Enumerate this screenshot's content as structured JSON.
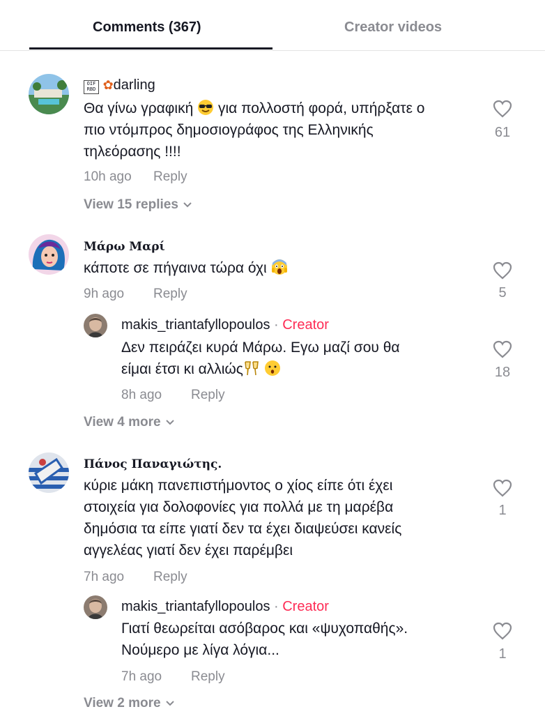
{
  "tabs": {
    "comments": "Comments (367)",
    "creator_videos": "Creator videos"
  },
  "comments": [
    {
      "username": "darling",
      "text_line1a": "Θα γίνω γραφική ",
      "text_line1b": "για πολλοστή φορά, υπήρξατε ο",
      "text_line2": "πιο ντόμπρος δημοσιογράφος της Ελληνικής",
      "text_line3": "τηλεόρασης !!!!",
      "time": "10h ago",
      "reply": "Reply",
      "likes": "61",
      "view_more": "View 15 replies"
    },
    {
      "username": "Μάρω Μαρί",
      "text": "κάποτε σε πήγαινα τώρα όχι ",
      "time": "9h ago",
      "reply": "Reply",
      "likes": "5",
      "reply_item": {
        "username": "makis_triantafyllopoulos",
        "sep": " · ",
        "badge": "Creator",
        "text_line1": "Δεν πειράζει κυρά Μάρω. Εγω μαζί σου θα",
        "text_line2": "είμαι έτσι κι αλλιώς",
        "time": "8h ago",
        "reply": "Reply",
        "likes": "18"
      },
      "view_more": "View 4 more"
    },
    {
      "username": "Πάνος Παναγιώτης.",
      "text_line1": "κύριε μάκη πανεπιστήμοντος ο χίος είπε ότι έχει",
      "text_line2": "στοιχεία για δολοφονίες για πολλά με τη μαρέβα",
      "text_line3": "δημόσια τα είπε γιατί δεν τα έχει διαψεύσει κανείς",
      "text_line4": "αγγελέας γιατί δεν έχει παρέμβει",
      "time": "7h ago",
      "reply": "Reply",
      "likes": "1",
      "reply_item": {
        "username": "makis_triantafyllopoulos",
        "sep": " · ",
        "badge": "Creator",
        "text_line1": "Γιατί θεωρείται ασόβαρος και «ψυχοπαθής».",
        "text_line2": "Νούμερο με λίγα λόγια...",
        "time": "7h ago",
        "reply": "Reply",
        "likes": "1"
      },
      "view_more": "View 2 more"
    }
  ],
  "colors": {
    "accent": "#fe2c55",
    "text": "#161823",
    "muted": "#8a8b91"
  }
}
